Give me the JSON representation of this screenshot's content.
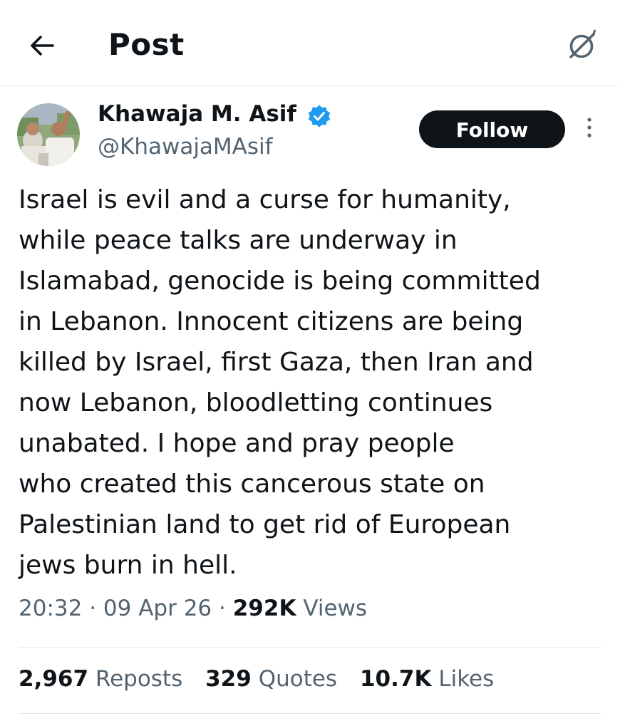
{
  "header": {
    "title": "Post",
    "back_icon": "arrow-left-icon",
    "grok_icon": "grok-icon"
  },
  "author": {
    "display_name": "Khawaja M. Asif",
    "handle": "@KhawajaMAsif",
    "verified": true,
    "verified_color": "#1d9bf0"
  },
  "actions": {
    "follow_label": "Follow",
    "more_icon": "more-vertical-icon"
  },
  "tweet": {
    "lines": [
      "Israel is evil and a curse for humanity,",
      "while peace talks are underway in",
      "Islamabad, genocide is being committed",
      "in Lebanon. Innocent citizens are being",
      "killed by Israel, first Gaza, then Iran and",
      "now Lebanon, bloodletting continues",
      "unabated. I hope and pray people",
      "who created this cancerous state on",
      "Palestinian land to get rid of European",
      "jews burn in hell."
    ]
  },
  "meta": {
    "time": "20:32",
    "date": "09 Apr 26",
    "views_count": "292K",
    "views_label": "Views",
    "separator": "·"
  },
  "stats": {
    "reposts_count": "2,967",
    "reposts_label": "Reposts",
    "quotes_count": "329",
    "quotes_label": "Quotes",
    "likes_count": "10.7K",
    "likes_label": "Likes"
  },
  "colors": {
    "text_primary": "#0f1419",
    "text_secondary": "#536471",
    "border": "#e6e9ec",
    "follow_bg": "#0f1419",
    "verified": "#1d9bf0"
  }
}
